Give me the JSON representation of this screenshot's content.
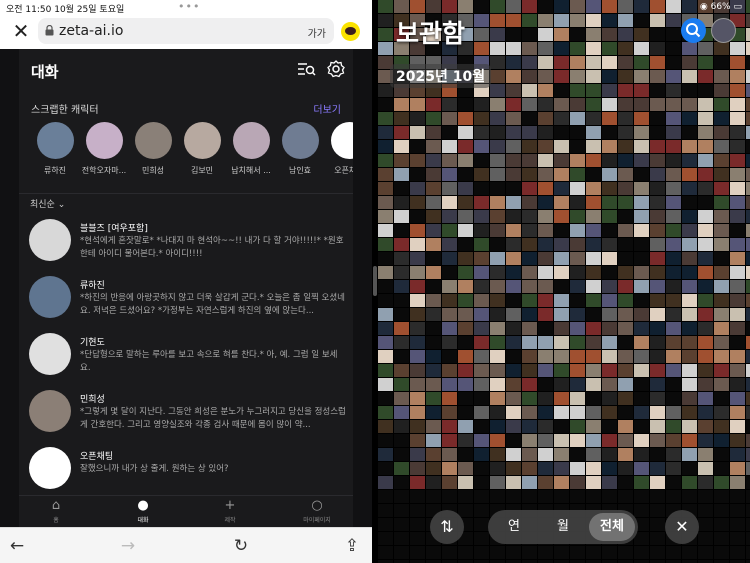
{
  "status_left": {
    "time": "오전 11:50",
    "date": "10월 25일 토요일"
  },
  "browser": {
    "url": "zeta-ai.io",
    "text_size": "가가"
  },
  "app": {
    "title": "대화",
    "scrap_title": "스크랩한 캐릭터",
    "more": "더보기",
    "characters": [
      {
        "name": "류하진",
        "color": "#6a7f99"
      },
      {
        "name": "전학오자마...",
        "color": "#c7b0c8"
      },
      {
        "name": "민희성",
        "color": "#8a8078"
      },
      {
        "name": "김보민",
        "color": "#b7a9a0"
      },
      {
        "name": "납치해서 ...",
        "color": "#b9a7b5"
      },
      {
        "name": "남인효",
        "color": "#6f7c92"
      },
      {
        "name": "오픈채팅",
        "color": "#ffffff"
      }
    ],
    "sort": "최신순",
    "chats": [
      {
        "name": "블블즈 [여우포함]",
        "message": "*현석에게 혼잣말로* *나대지 마 현석아~~!! 내가 다 할 거야!!!!!* *원호한테 아이디 물어본다.* 아이디!!!!",
        "color": "#d8d8d8"
      },
      {
        "name": "류하진",
        "message": "*하진의 반응에 아랑곳하지 않고 더욱 살갑게 군다.* 오늘은 좀 일찍 오셨네요. 저녁은 드셨어요? *가정부는 자연스럽게 하진의 옆에 앉는다...",
        "color": "#5f7590"
      },
      {
        "name": "기현도",
        "message": "*단답형으로 말하는 루아를 보고 속으로 혀를 찬다.* 아, 예. 그럼 일 보세요.",
        "color": "#e0e0e0"
      },
      {
        "name": "민희성",
        "message": "*그렇게 몇 달이 지난다. 그동안 희성은 분노가 누그러지고 당신을 정성스럽게 간호한다. 그리고 영양실조와 각종 검사 때문에 몸이 많이 약...",
        "color": "#8b7f76"
      },
      {
        "name": "오픈채팅",
        "message": "잘했으니까 내가 상 줄게. 원하는 상 있어?",
        "color": "#ffffff"
      }
    ],
    "tabs": [
      {
        "label": "홈",
        "icon": "⌂"
      },
      {
        "label": "대화",
        "icon": "●"
      },
      {
        "label": "제작",
        "icon": "+"
      },
      {
        "label": "마이페이지",
        "icon": "○"
      }
    ]
  },
  "gallery": {
    "battery": "66%",
    "title": "보관함",
    "date_chip": "2025년 10월",
    "segments": [
      "연",
      "월",
      "전체"
    ],
    "active_segment": "전체"
  }
}
